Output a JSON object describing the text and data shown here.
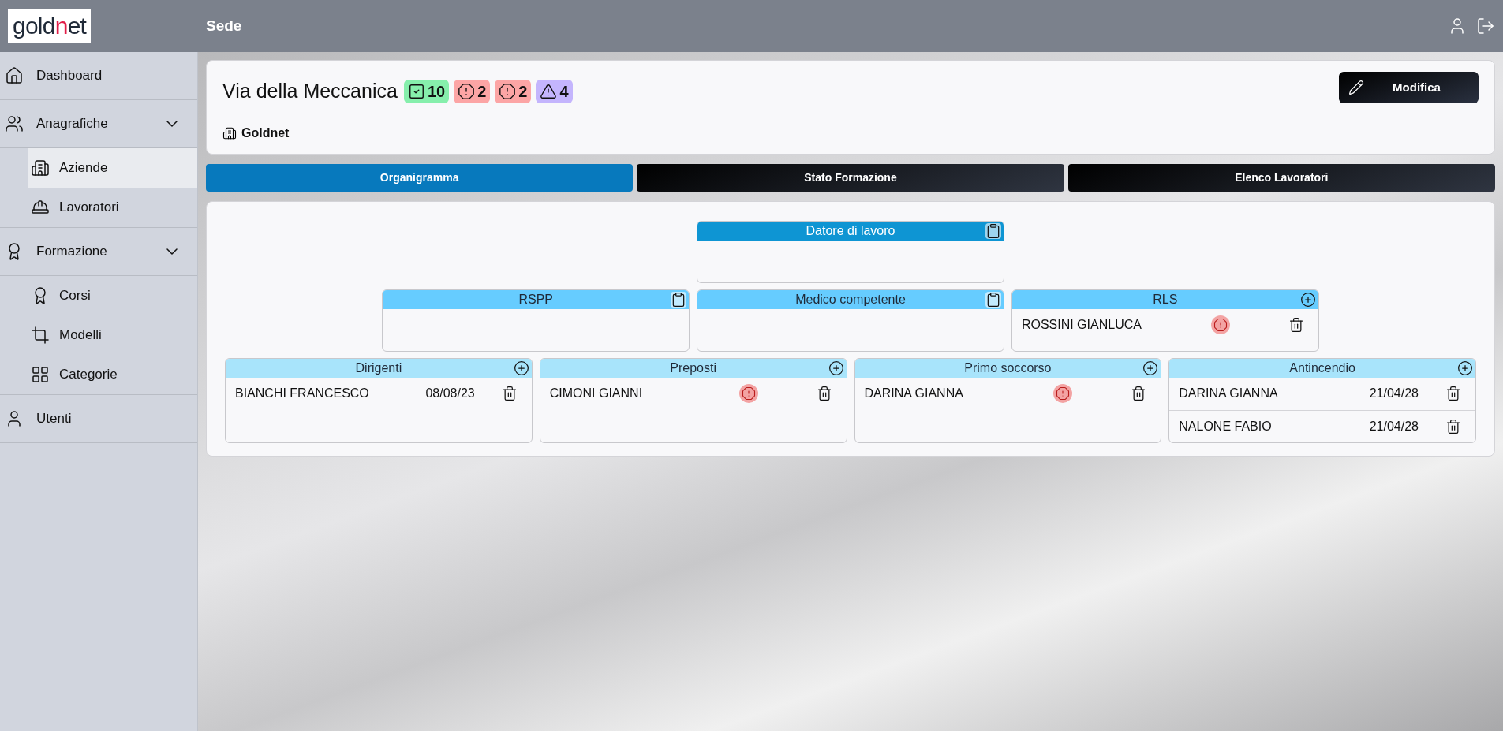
{
  "logo": {
    "text_start": "gold",
    "text_accent": "n",
    "text_end": "et"
  },
  "header": {
    "title": "Sede"
  },
  "sidebar": {
    "items": [
      {
        "label": "Dashboard",
        "selected": false
      },
      {
        "label": "Anagrafiche",
        "expanded": true,
        "selected": false,
        "children": [
          {
            "label": "Aziende",
            "selected": true
          },
          {
            "label": "Lavoratori",
            "selected": false
          }
        ]
      },
      {
        "label": "Formazione",
        "expanded": true,
        "selected": false,
        "children": [
          {
            "label": "Corsi",
            "selected": false
          },
          {
            "label": "Modelli",
            "selected": false
          },
          {
            "label": "Categorie",
            "selected": false
          }
        ]
      },
      {
        "label": "Utenti",
        "selected": false
      }
    ]
  },
  "site": {
    "title": "Via della Meccanica",
    "badges": [
      {
        "kind": "ok",
        "count": "10"
      },
      {
        "kind": "error",
        "count": "2"
      },
      {
        "kind": "error",
        "count": "2"
      },
      {
        "kind": "warning",
        "count": "4"
      }
    ],
    "company": "Goldnet",
    "edit_button": "Modifica"
  },
  "tabs": [
    {
      "label": "Organigramma",
      "selected": true
    },
    {
      "label": "Stato Formazione",
      "selected": false
    },
    {
      "label": "Elenco Lavoratori",
      "selected": false
    }
  ],
  "org_chart": {
    "rows": [
      {
        "nodes": [
          {
            "title": "Datore di lavoro",
            "kind": "single"
          }
        ]
      },
      {
        "nodes": [
          {
            "title": "RSPP",
            "kind": "single"
          },
          {
            "title": "Medico competente",
            "kind": "single"
          },
          {
            "title": "RLS",
            "kind": "group",
            "members": [
              {
                "name": "ROSSINI GIANLUCA",
                "alert": true
              }
            ]
          }
        ]
      },
      {
        "nodes": [
          {
            "title": "Dirigenti",
            "kind": "group",
            "members": [
              {
                "name": "BIANCHI FRANCESCO",
                "date": "08/08/23",
                "alert": false
              }
            ]
          },
          {
            "title": "Preposti",
            "kind": "group",
            "members": [
              {
                "name": "CIMONI GIANNI",
                "alert": true
              }
            ]
          },
          {
            "title": "Primo soccorso",
            "kind": "group",
            "members": [
              {
                "name": "DARINA GIANNA",
                "alert": true
              }
            ]
          },
          {
            "title": "Antincendio",
            "kind": "group",
            "members": [
              {
                "name": "DARINA GIANNA",
                "date": "21/04/28",
                "alert": false
              },
              {
                "name": "NALONE FABIO",
                "date": "21/04/28",
                "alert": false
              }
            ]
          }
        ]
      }
    ]
  }
}
